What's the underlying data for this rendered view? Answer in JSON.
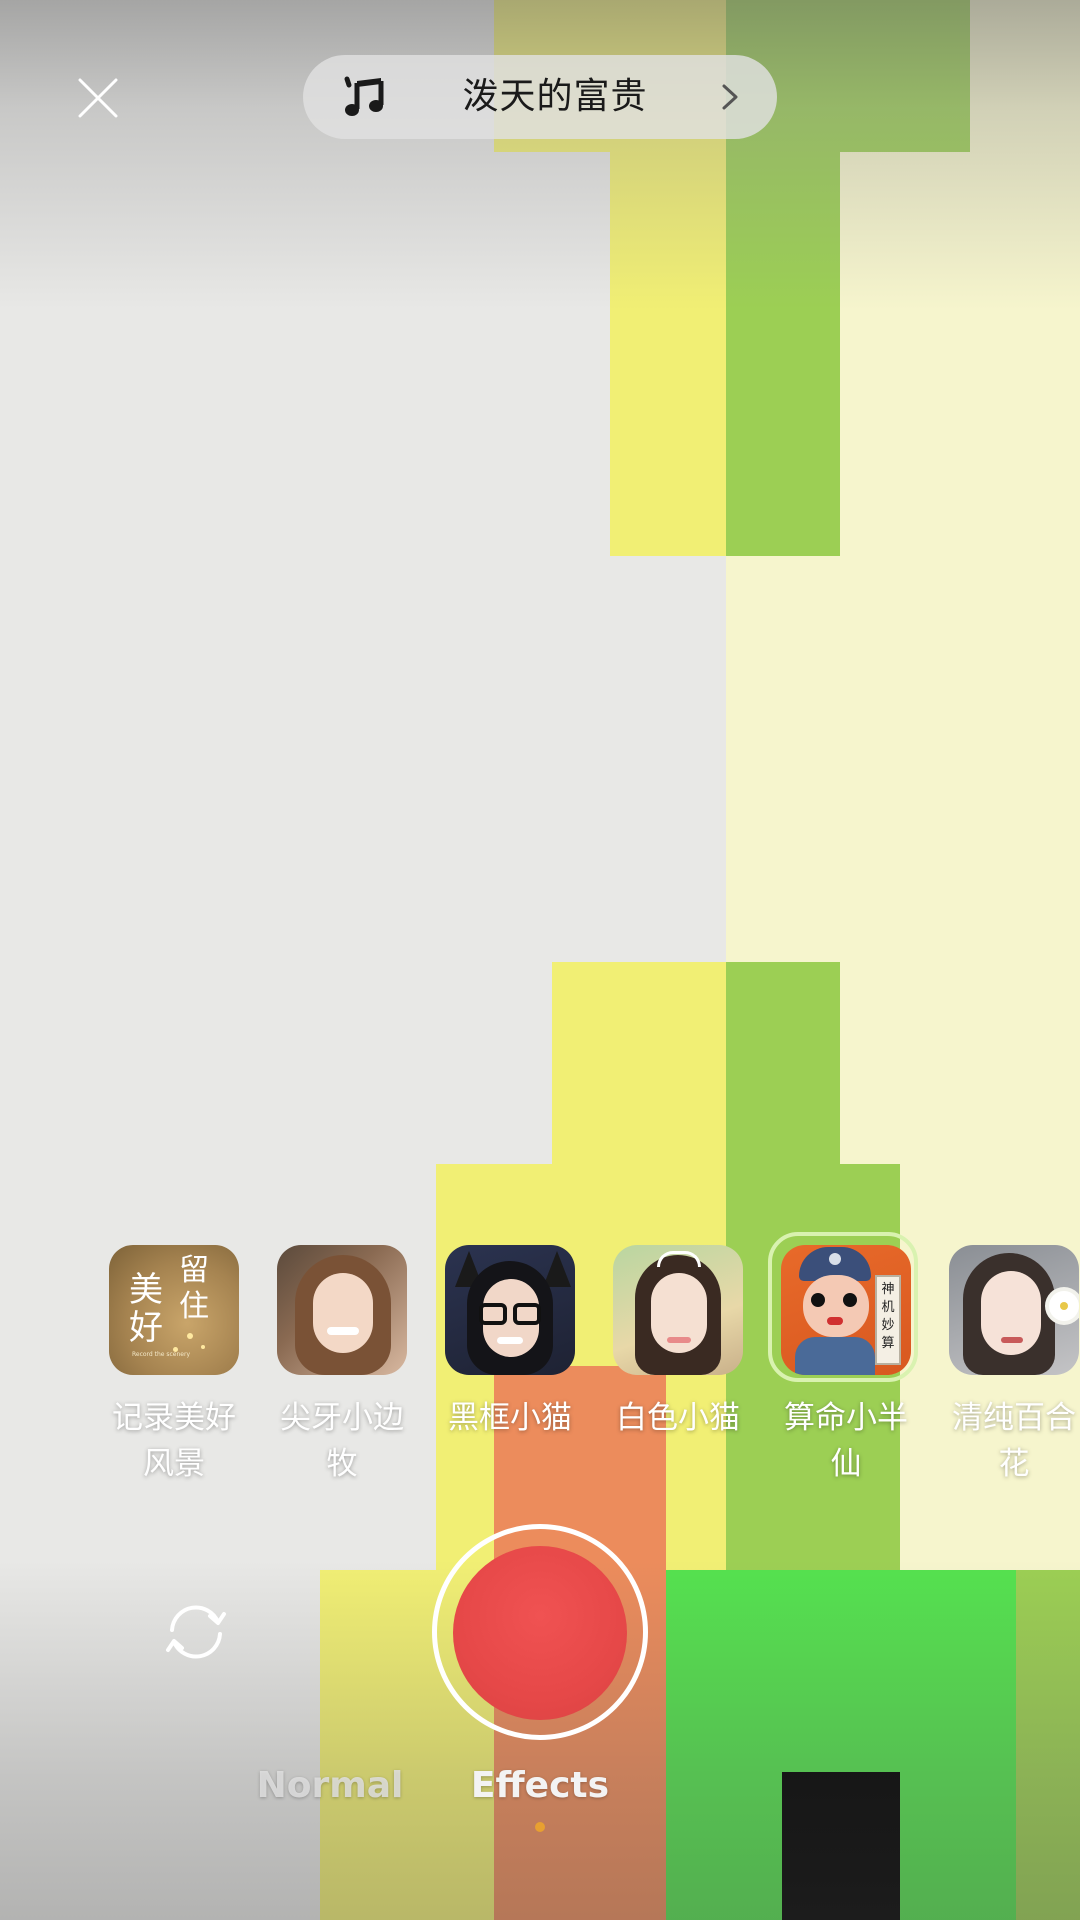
{
  "colors": {
    "yellow": "#f1ef74",
    "green": "#9ccf54",
    "cream": "#f6f5cd",
    "gray": "#e8e8e6",
    "orange": "#ec8c5c",
    "bright_green": "#55e24f",
    "black": "#000000",
    "record_red": "#e94b4b",
    "selected_ring": "#d9f2b0",
    "mode_dot": "#e8a030"
  },
  "top_bar": {
    "close_icon": "close-icon",
    "music": {
      "icon": "music-note-icon",
      "title": "泼天的富贵",
      "chevron_icon": "chevron-right-icon"
    }
  },
  "effects": [
    {
      "label": "记录美好风景",
      "thumb_text": [
        "美",
        "好",
        "留",
        "住"
      ],
      "thumb_caption": "Record the scenery",
      "selected": false
    },
    {
      "label": "尖牙小边牧",
      "selected": false
    },
    {
      "label": "黑框小猫",
      "selected": false
    },
    {
      "label": "白色小猫",
      "selected": false
    },
    {
      "label": "算命小半仙",
      "thumb_text": [
        "神",
        "机",
        "妙",
        "算"
      ],
      "selected": true
    },
    {
      "label": "清纯百合花",
      "selected": false
    }
  ],
  "controls": {
    "flip_camera_icon": "flip-camera-icon",
    "record_button": "record-button"
  },
  "modes": {
    "normal": "Normal",
    "effects": "Effects",
    "active": "effects"
  }
}
